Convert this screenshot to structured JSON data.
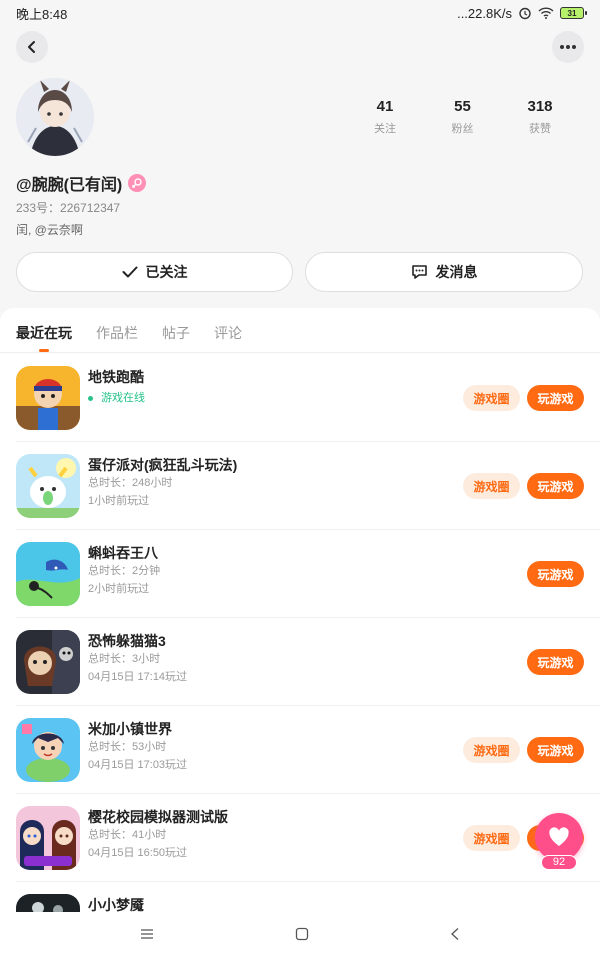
{
  "status_bar": {
    "time": "晚上8:48",
    "network_speed": "...22.8K/s",
    "battery": "31"
  },
  "profile": {
    "username": "@腕腕(已有闰)",
    "uid": "233号：226712347",
    "bio": "闰, @云奈啊",
    "stats": [
      {
        "num": "41",
        "label": "关注"
      },
      {
        "num": "55",
        "label": "粉丝"
      },
      {
        "num": "318",
        "label": "获赞"
      }
    ],
    "follow_label": "已关注",
    "message_label": "发消息"
  },
  "tabs": [
    "最近在玩",
    "作品栏",
    "帖子",
    "评论"
  ],
  "games": [
    {
      "name": "地铁跑酷",
      "online": "游戏在线",
      "meta1": "",
      "meta2": "",
      "circle": "游戏圈",
      "play": "玩游戏"
    },
    {
      "name": "蛋仔派对(疯狂乱斗玩法)",
      "meta1": "总时长：248小时",
      "meta2": "1小时前玩过",
      "circle": "游戏圈",
      "play": "玩游戏"
    },
    {
      "name": "蝌蚪吞王八",
      "meta1": "总时长：2分钟",
      "meta2": "2小时前玩过",
      "play": "玩游戏"
    },
    {
      "name": "恐怖躲猫猫3",
      "meta1": "总时长：3小时",
      "meta2": "04月15日 17:14玩过",
      "play": "玩游戏"
    },
    {
      "name": "米加小镇世界",
      "meta1": "总时长：53小时",
      "meta2": "04月15日 17:03玩过",
      "circle": "游戏圈",
      "play": "玩游戏"
    },
    {
      "name": "樱花校园模拟器测试版",
      "meta1": "总时长：41小时",
      "meta2": "04月15日 16:50玩过",
      "circle": "游戏圈",
      "play": "玩游戏"
    },
    {
      "name": "小小梦魇",
      "meta1": "",
      "meta2": ""
    }
  ],
  "like_count": "92",
  "colors": {
    "accent": "#ff6a13",
    "accent_light": "#fdebdd",
    "pink": "#ff4f8b",
    "online_green": "#27c38a"
  },
  "icons": [
    "back-arrow-icon",
    "more-dots-icon",
    "female-icon",
    "check-icon",
    "chat-bubble-icon",
    "heart-icon",
    "menu-icon",
    "home-square-icon",
    "back-triangle-icon"
  ]
}
